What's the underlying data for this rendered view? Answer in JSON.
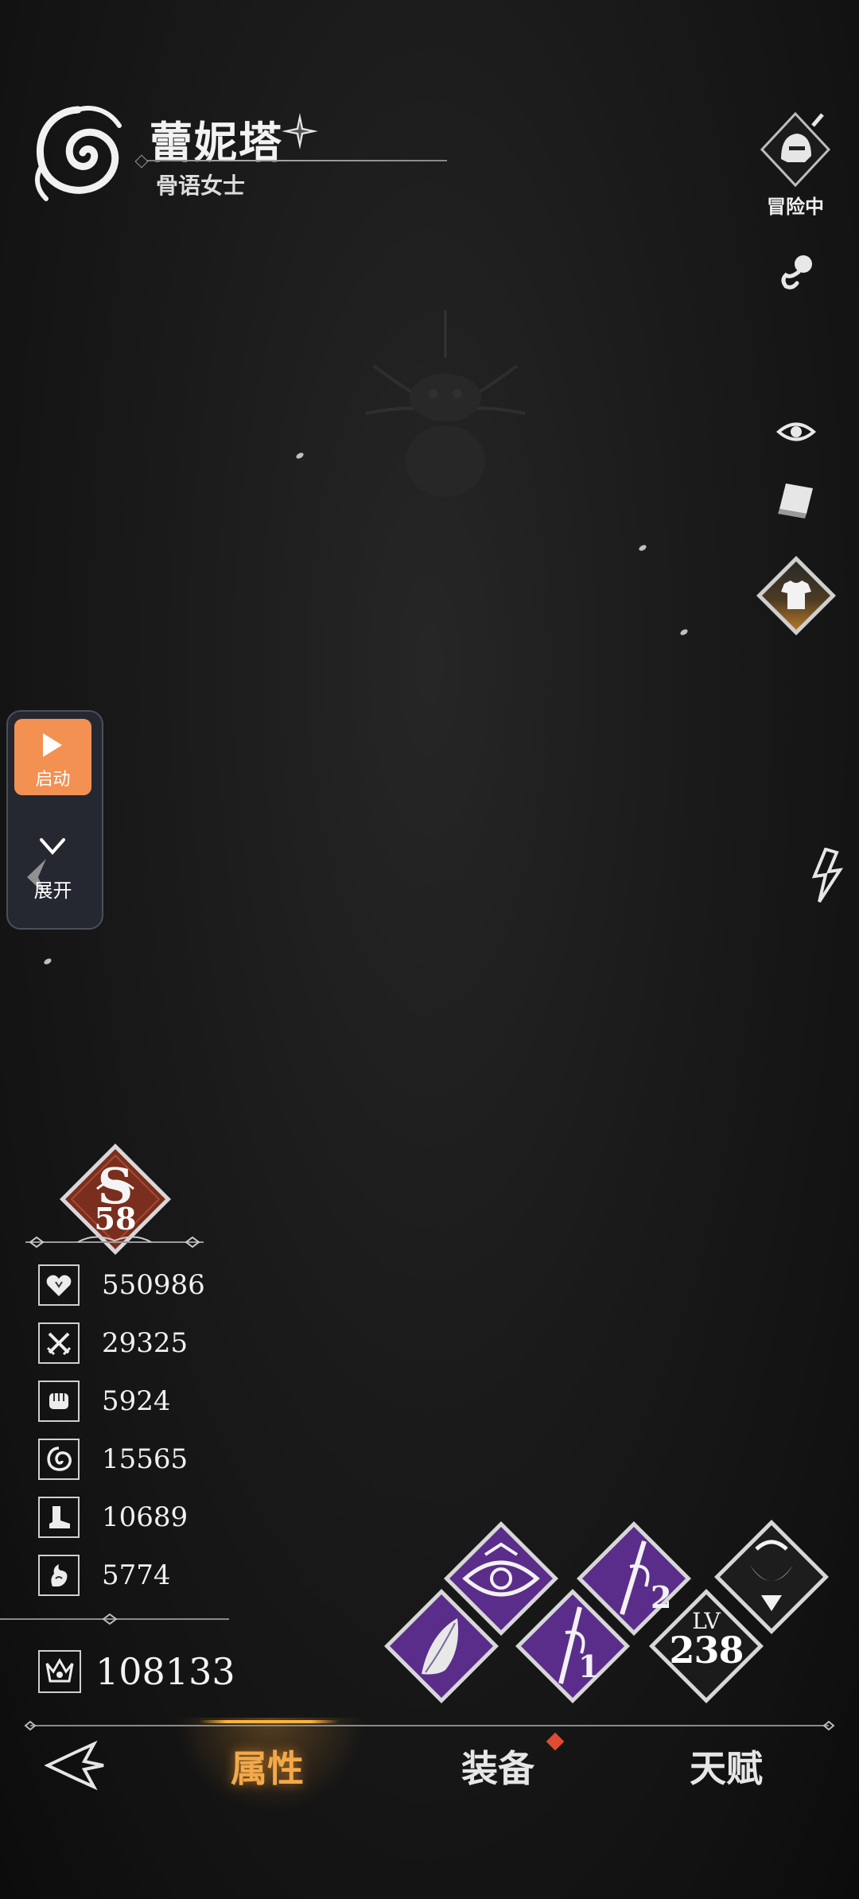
{
  "header": {
    "name": "蕾妮塔",
    "subtitle": "骨语女士",
    "emblem_icon": "spiral-emblem-icon",
    "title_icon": "compass-star-icon"
  },
  "right_bar": {
    "adventure_label": "冒险中",
    "icons": [
      "knight-helmet-icon",
      "pacifier-icon",
      "eye-icon",
      "card-icon",
      "outfit-icon",
      "lightning-icon"
    ]
  },
  "float_panel": {
    "start_label": "启动",
    "expand_label": "展开",
    "start_color": "#f39152"
  },
  "rank": {
    "letter": "S",
    "level": "58",
    "badge_color": "#7a2e1e"
  },
  "stats": [
    {
      "icon": "heart-icon",
      "value": "550986"
    },
    {
      "icon": "crossed-swords-icon",
      "value": "29325"
    },
    {
      "icon": "fist-icon",
      "value": "5924"
    },
    {
      "icon": "spiral-icon",
      "value": "15565"
    },
    {
      "icon": "boot-icon",
      "value": "10689"
    },
    {
      "icon": "flame-hand-icon",
      "value": "5774"
    }
  ],
  "power": {
    "icon": "crown-sigil-icon",
    "value": "108133"
  },
  "skills": {
    "lv_label": "LV",
    "lv_value": "238",
    "skill2_label": "2",
    "skill1_label": "1",
    "accent": "#5b2d8a"
  },
  "nav": {
    "tabs": [
      "属性",
      "装备",
      "天赋"
    ],
    "active_color": "#f3a94a"
  }
}
